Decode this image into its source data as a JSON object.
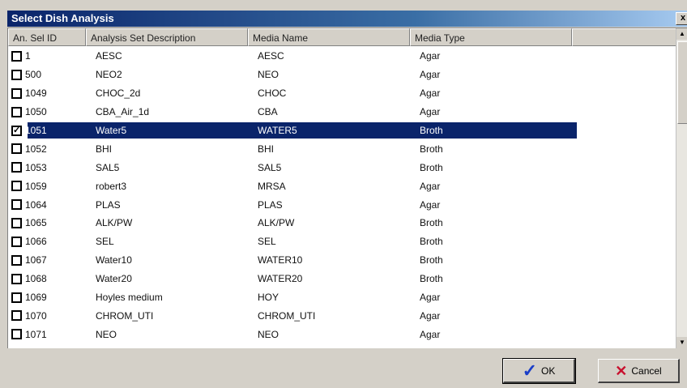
{
  "window": {
    "title": "Select Dish Analysis",
    "close_glyph": "x"
  },
  "columns": [
    "An. Sel ID",
    "Analysis Set Description",
    "Media Name",
    "Media Type"
  ],
  "rows": [
    {
      "checked": false,
      "id": "1",
      "desc": "AESC",
      "media": "AESC",
      "type": "Agar"
    },
    {
      "checked": false,
      "id": "500",
      "desc": "NEO2",
      "media": "NEO",
      "type": "Agar"
    },
    {
      "checked": false,
      "id": "1049",
      "desc": "CHOC_2d",
      "media": "CHOC",
      "type": "Agar"
    },
    {
      "checked": false,
      "id": "1050",
      "desc": "CBA_Air_1d",
      "media": "CBA",
      "type": "Agar"
    },
    {
      "checked": true,
      "selected": true,
      "id": "1051",
      "desc": "Water5",
      "media": "WATER5",
      "type": "Broth"
    },
    {
      "checked": false,
      "id": "1052",
      "desc": "BHI",
      "media": "BHI",
      "type": "Broth"
    },
    {
      "checked": false,
      "id": "1053",
      "desc": "SAL5",
      "media": "SAL5",
      "type": "Broth"
    },
    {
      "checked": false,
      "id": "1059",
      "desc": "robert3",
      "media": "MRSA",
      "type": "Agar"
    },
    {
      "checked": false,
      "id": "1064",
      "desc": "PLAS",
      "media": "PLAS",
      "type": "Agar"
    },
    {
      "checked": false,
      "id": "1065",
      "desc": "ALK/PW",
      "media": "ALK/PW",
      "type": "Broth"
    },
    {
      "checked": false,
      "id": "1066",
      "desc": "SEL",
      "media": "SEL",
      "type": "Broth"
    },
    {
      "checked": false,
      "id": "1067",
      "desc": "Water10",
      "media": "WATER10",
      "type": "Broth"
    },
    {
      "checked": false,
      "id": "1068",
      "desc": "Water20",
      "media": "WATER20",
      "type": "Broth"
    },
    {
      "checked": false,
      "id": "1069",
      "desc": "Hoyles medium",
      "media": "HOY",
      "type": "Agar"
    },
    {
      "checked": false,
      "id": "1070",
      "desc": "CHROM_UTI",
      "media": "CHROM_UTI",
      "type": "Agar"
    },
    {
      "checked": false,
      "id": "1071",
      "desc": "NEO",
      "media": "NEO",
      "type": "Agar"
    }
  ],
  "buttons": {
    "ok": "OK",
    "cancel": "Cancel"
  },
  "icons": {
    "ok": "checkmark-icon",
    "cancel": "x-icon"
  }
}
